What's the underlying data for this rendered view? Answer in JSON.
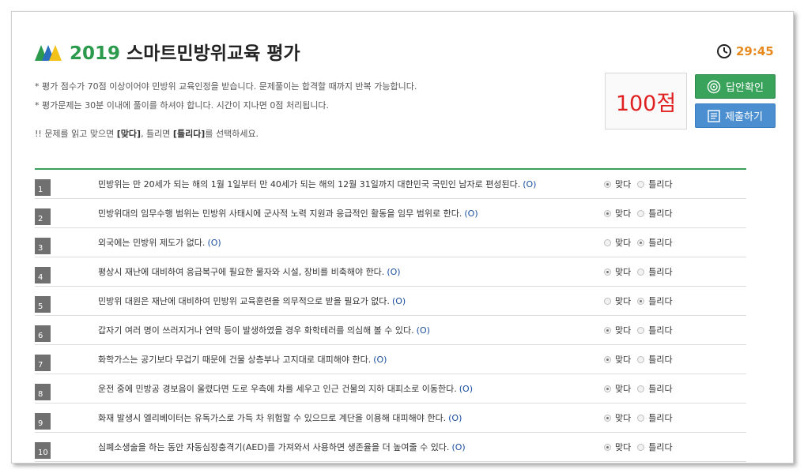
{
  "header": {
    "year": "2019",
    "title": "스마트민방위교육 평가",
    "timer": "29:45"
  },
  "notes": [
    "* 평가 점수가 70점 이상이어야 민방위 교육인정을 받습니다. 문제풀이는 합격할 때까지 반복 가능합니다.",
    "* 평가문제는 30분 이내에 풀이를 하셔야 합니다. 시간이 지나면 0점 처리됩니다."
  ],
  "instruction": {
    "prefix": "!! 문제를 읽고 맞으면 ",
    "yes": "[맞다]",
    "middle": ", 틀리면 ",
    "no": "[틀리다]",
    "suffix": "를 선택하세요."
  },
  "score": "100점",
  "buttons": {
    "answer": "답안확인",
    "submit": "제출하기"
  },
  "options": {
    "yes": "맞다",
    "no": "틀리다"
  },
  "questions": [
    {
      "num": "1",
      "text": "민방위는 만 20세가 되는 해의 1월 1일부터 만 40세가 되는 해의 12월 31일까지 대한민국 국민인 남자로 편성된다.",
      "answer": "(O)",
      "selected": "yes"
    },
    {
      "num": "2",
      "text": "민방위대의 임무수행 범위는 민방위 사태시에 군사적 노력 지원과 응급적인 활동을 임무 범위로 한다.",
      "answer": "(O)",
      "selected": "yes"
    },
    {
      "num": "3",
      "text": "외국에는 민방위 제도가 없다.",
      "answer": "(O)",
      "selected": "no"
    },
    {
      "num": "4",
      "text": "평상시 재난에 대비하여 응급복구에 필요한 물자와 시설, 장비를 비축해야 한다.",
      "answer": "(O)",
      "selected": "yes"
    },
    {
      "num": "5",
      "text": "민방위 대원은 재난에 대비하여 민방위 교육훈련을 의무적으로 받을 필요가 없다.",
      "answer": "(O)",
      "selected": "no"
    },
    {
      "num": "6",
      "text": "갑자기 여러 명이 쓰러지거나 연막 등이 발생하였을 경우 화학테러를 의심해 볼 수 있다.",
      "answer": "(O)",
      "selected": "yes"
    },
    {
      "num": "7",
      "text": "화학가스는 공기보다 무겁기 때문에 건물 상층부나 고지대로 대피해야 한다.",
      "answer": "(O)",
      "selected": "yes"
    },
    {
      "num": "8",
      "text": "운전 중에 민방공 경보음이 울렸다면 도로 우측에 차를 세우고 인근 건물의 지하 대피소로 이동한다.",
      "answer": "(O)",
      "selected": "yes"
    },
    {
      "num": "9",
      "text": "화재 발생시 엘리베이터는 유독가스로 가득 차 위험할 수 있으므로 계단을 이용해 대피해야 한다.",
      "answer": "(O)",
      "selected": "yes"
    },
    {
      "num": "10",
      "text": "심폐소생술을 하는 동안 자동심장충격기(AED)를 가져와서 사용하면 생존율을 더 높여줄 수 있다.",
      "answer": "(O)",
      "selected": "yes"
    }
  ]
}
